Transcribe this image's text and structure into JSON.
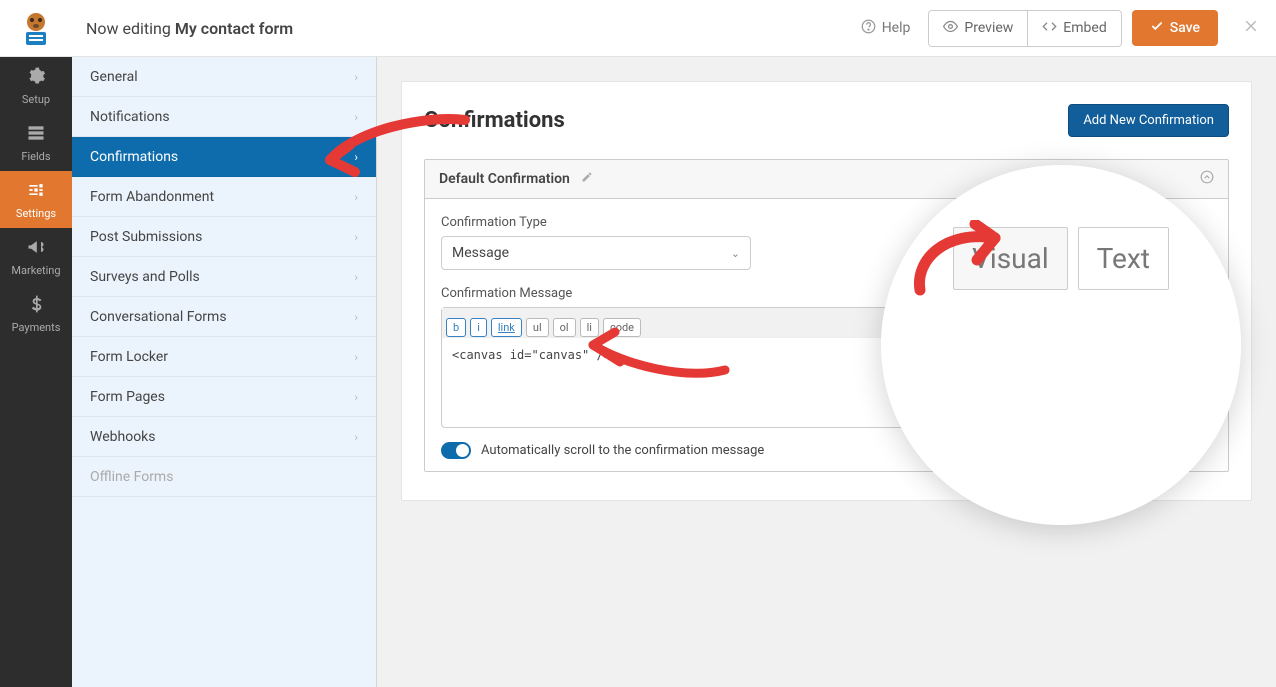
{
  "header": {
    "now_editing_prefix": "Now editing ",
    "form_name": "My contact form",
    "help": "Help",
    "preview": "Preview",
    "embed": "Embed",
    "save": "Save"
  },
  "rail": {
    "setup": "Setup",
    "fields": "Fields",
    "settings": "Settings",
    "marketing": "Marketing",
    "payments": "Payments"
  },
  "sidebar": {
    "items": [
      {
        "label": "General"
      },
      {
        "label": "Notifications"
      },
      {
        "label": "Confirmations"
      },
      {
        "label": "Form Abandonment"
      },
      {
        "label": "Post Submissions"
      },
      {
        "label": "Surveys and Polls"
      },
      {
        "label": "Conversational Forms"
      },
      {
        "label": "Form Locker"
      },
      {
        "label": "Form Pages"
      },
      {
        "label": "Webhooks"
      },
      {
        "label": "Offline Forms"
      }
    ]
  },
  "main": {
    "title": "Confirmations",
    "add_btn": "Add New Confirmation",
    "confirm_title": "Default Confirmation",
    "type_label": "Confirmation Type",
    "type_value": "Message",
    "msg_label": "Confirmation Message",
    "toolbar": {
      "b": "b",
      "i": "i",
      "link": "link",
      "ul": "ul",
      "ol": "ol",
      "li": "li",
      "code": "code"
    },
    "editor_content": "<canvas id=\"canvas\" />",
    "auto_scroll": "Automatically scroll to the confirmation message"
  },
  "zoom": {
    "visual": "Visual",
    "text": "Text"
  }
}
